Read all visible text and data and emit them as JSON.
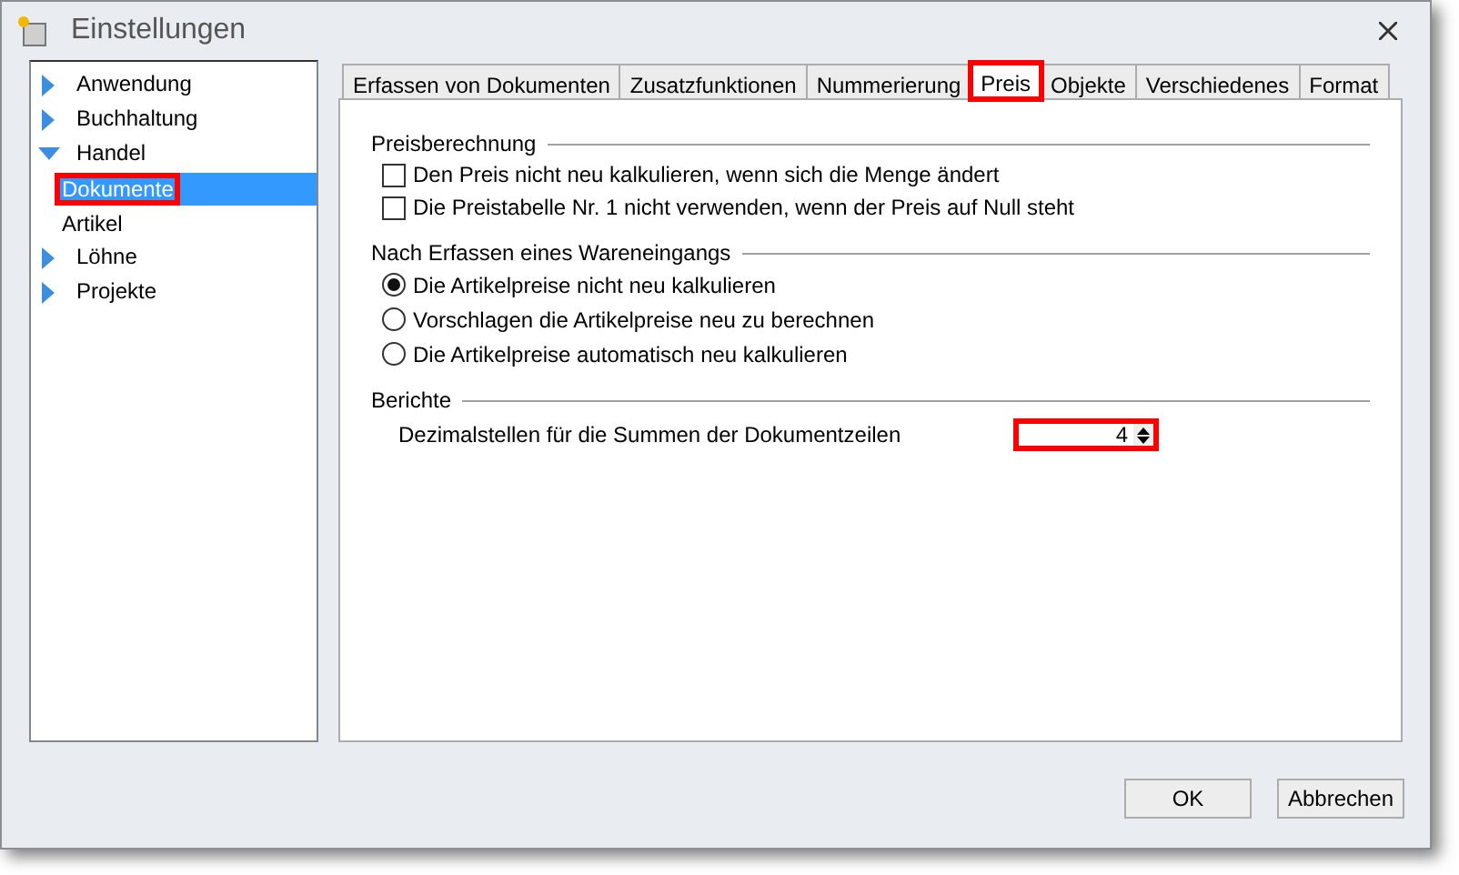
{
  "window": {
    "title": "Einstellungen"
  },
  "tree": [
    {
      "label": "Anwendung",
      "expanded": false,
      "selected": false,
      "highlighted": false
    },
    {
      "label": "Buchhaltung",
      "expanded": false,
      "selected": false,
      "highlighted": false
    },
    {
      "label": "Handel",
      "expanded": true,
      "selected": false,
      "highlighted": false,
      "children": [
        {
          "label": "Dokumente",
          "selected": true,
          "highlighted": true
        },
        {
          "label": "Artikel",
          "selected": false,
          "highlighted": false
        }
      ]
    },
    {
      "label": "Löhne",
      "expanded": false,
      "selected": false,
      "highlighted": false
    },
    {
      "label": "Projekte",
      "expanded": false,
      "selected": false,
      "highlighted": false
    }
  ],
  "tabs": [
    {
      "label": "Erfassen von Dokumenten",
      "selected": false,
      "highlighted": false
    },
    {
      "label": "Zusatzfunktionen",
      "selected": false,
      "highlighted": false
    },
    {
      "label": "Nummerierung",
      "selected": false,
      "highlighted": false
    },
    {
      "label": "Preis",
      "selected": true,
      "highlighted": true
    },
    {
      "label": "Objekte",
      "selected": false,
      "highlighted": false
    },
    {
      "label": "Verschiedenes",
      "selected": false,
      "highlighted": false
    },
    {
      "label": "Format",
      "selected": false,
      "highlighted": false
    }
  ],
  "groups": [
    {
      "title": "Preisberechnung",
      "items": [
        {
          "kind": "checkbox",
          "label": "Den Preis nicht neu kalkulieren, wenn sich die Menge ändert",
          "checked": false
        },
        {
          "kind": "checkbox",
          "label": "Die Preistabelle Nr. 1 nicht verwenden, wenn der Preis auf Null steht",
          "checked": false
        }
      ]
    },
    {
      "title": "Nach Erfassen eines Wareneingangs",
      "items": [
        {
          "kind": "radio",
          "label": "Die Artikelpreise nicht neu kalkulieren",
          "selected": true
        },
        {
          "kind": "radio",
          "label": "Vorschlagen die Artikelpreise neu zu berechnen",
          "selected": false
        },
        {
          "kind": "radio",
          "label": "Die Artikelpreise automatisch neu kalkulieren",
          "selected": false
        }
      ]
    },
    {
      "title": "Berichte",
      "items": [
        {
          "kind": "spinner",
          "label": "Dezimalstellen für die Summen der Dokumentzeilen",
          "value": "4",
          "highlighted": true
        }
      ]
    }
  ],
  "buttons": [
    "OK",
    "Abbrechen"
  ]
}
